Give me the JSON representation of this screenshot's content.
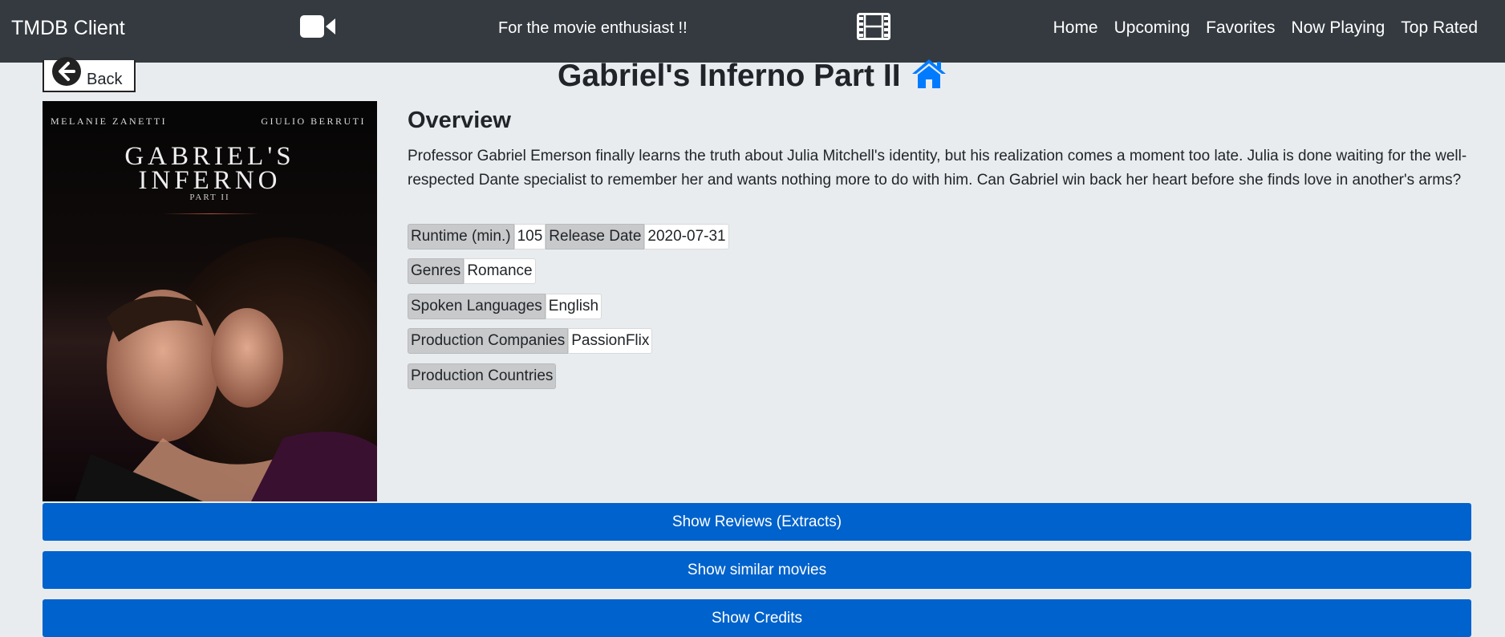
{
  "navbar": {
    "brand": "TMDB Client",
    "tagline": "For the movie enthusiast !!",
    "links": [
      "Home",
      "Upcoming",
      "Favorites",
      "Now Playing",
      "Top Rated"
    ],
    "icons": [
      "video-camera-icon",
      "film-icon"
    ]
  },
  "back": {
    "label": "Back",
    "icon": "arrow-circle-left-icon"
  },
  "movie": {
    "title": "Gabriel's Inferno Part II",
    "home_icon": "home-icon",
    "home_icon_color": "#007bff",
    "poster": {
      "actor_left": "MELANIE ZANETTI",
      "actor_right": "GIULIO BERRUTI",
      "title_line1": "GABRIEL'S",
      "title_line2": "INFERNO",
      "subtitle": "PART II"
    },
    "overview_heading": "Overview",
    "overview": "Professor Gabriel Emerson finally learns the truth about Julia Mitchell's identity, but his realization comes a moment too late. Julia is done waiting for the well-respected Dante specialist to remember her and wants nothing more to do with him. Can Gabriel win back her heart before she finds love in another's arms?",
    "details": {
      "runtime_label": "Runtime (min.)",
      "runtime": "105",
      "release_label": "Release Date",
      "release_date": "2020-07-31",
      "genres_label": "Genres",
      "genres": "Romance",
      "languages_label": "Spoken Languages",
      "languages": "English",
      "companies_label": "Production Companies",
      "companies": "PassionFlix",
      "countries_label": "Production Countries"
    }
  },
  "buttons": {
    "reviews": "Show Reviews (Extracts)",
    "similar": "Show similar movies",
    "credits": "Show Credits"
  },
  "colors": {
    "navbar": "#343a40",
    "background": "#e9ecef",
    "primary_button": "#0062cc"
  }
}
